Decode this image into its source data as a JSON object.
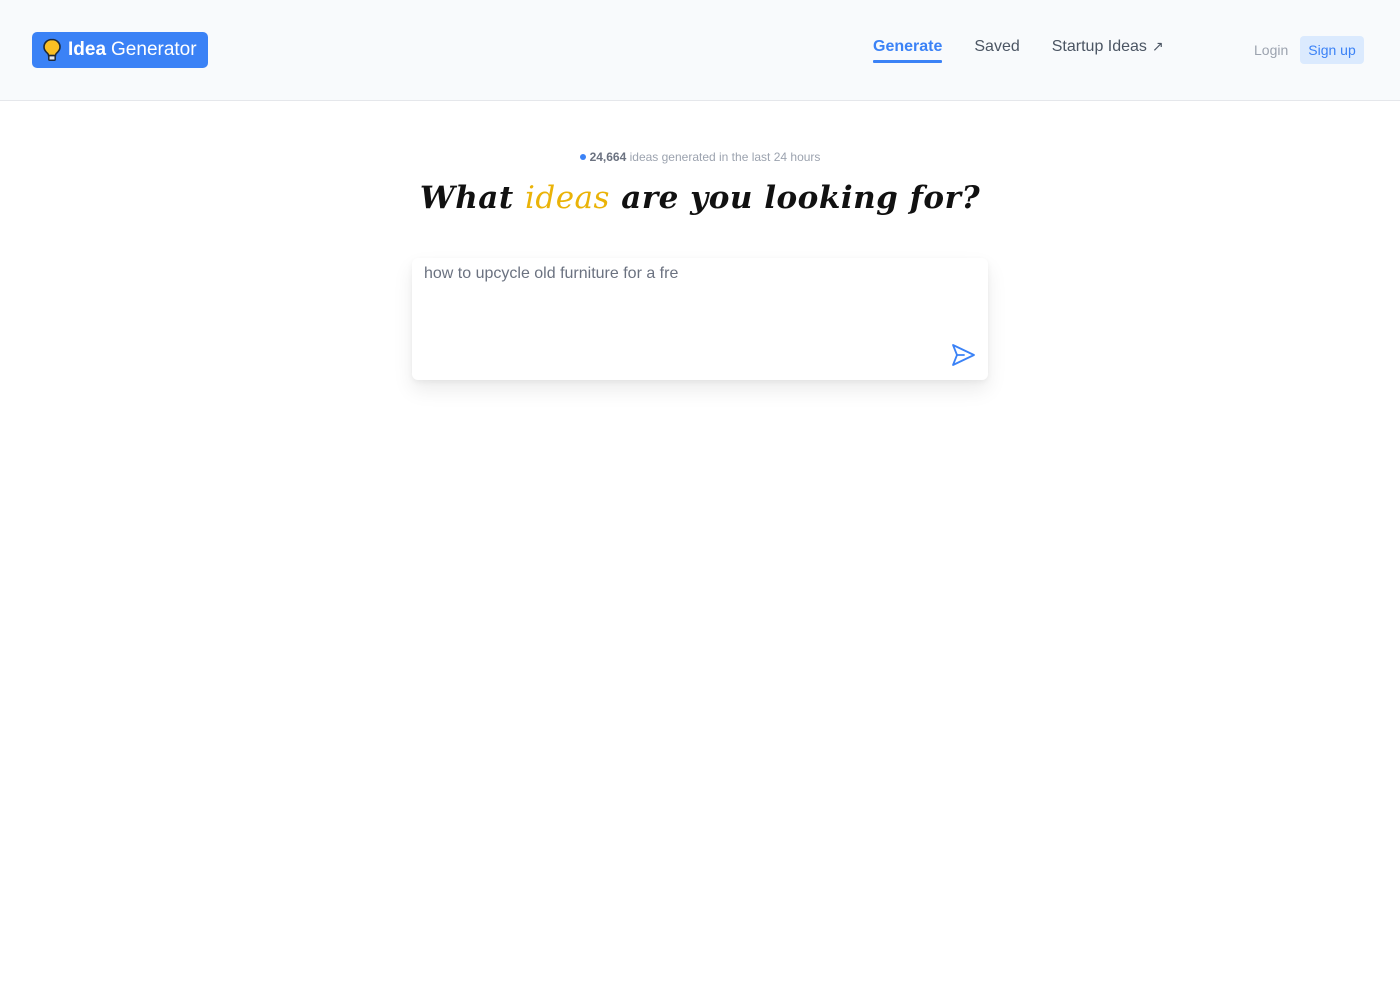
{
  "header": {
    "logo": {
      "bold": "Idea",
      "rest": "Generator",
      "icon": "lightbulb-icon"
    },
    "nav": [
      {
        "label": "Generate",
        "active": true
      },
      {
        "label": "Saved",
        "active": false
      },
      {
        "label": "Startup Ideas",
        "active": false,
        "external_icon": "↗"
      }
    ],
    "auth": {
      "login_label": "Login",
      "signup_label": "Sign up"
    }
  },
  "main": {
    "counter": {
      "count": "24,664",
      "text": "ideas generated in the last 24 hours"
    },
    "headline": {
      "before": "What",
      "accent": "ideas",
      "after": "are you looking for?"
    },
    "input": {
      "value": "how to upcycle old furniture for a fre",
      "send_icon": "send-icon"
    }
  },
  "colors": {
    "accent": "#3b82f6",
    "highlight": "#eab308",
    "signup_bg": "#dbeafe",
    "header_bg": "#f8fafc"
  }
}
